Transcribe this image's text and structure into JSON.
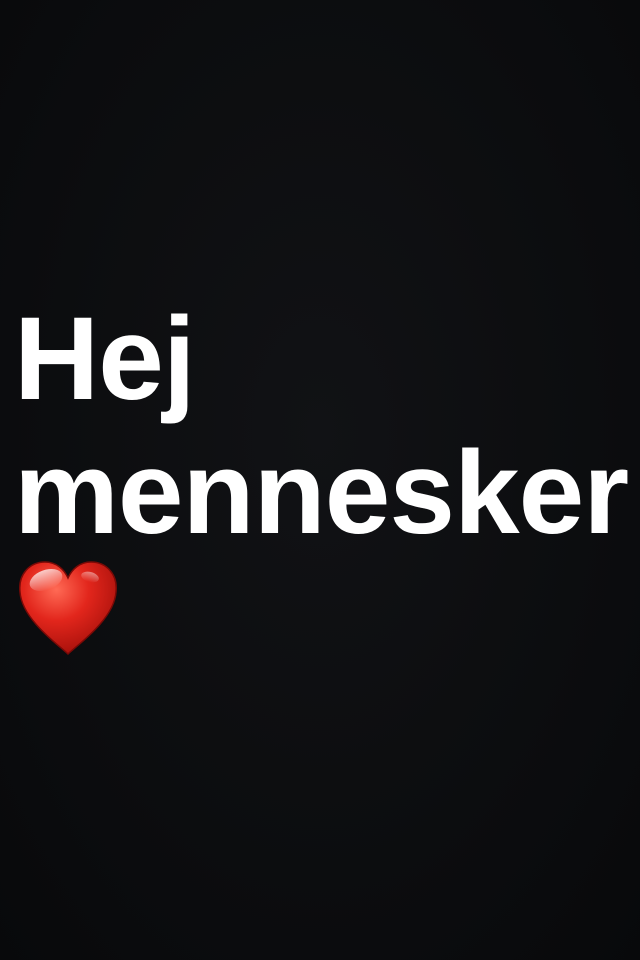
{
  "caption": {
    "line1": "Hej",
    "line2": "mennesker"
  },
  "emoji": {
    "icon": "red-heart-icon",
    "color": "#e2261c"
  },
  "background_color": "#0c0d0f"
}
